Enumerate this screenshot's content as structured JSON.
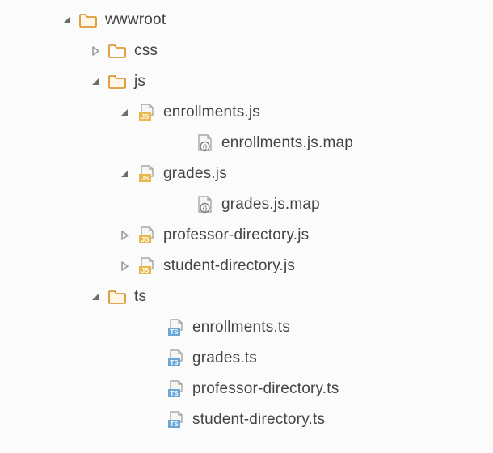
{
  "colors": {
    "folder_fill": "#ffffff",
    "folder_fill_open": "#fff6e6",
    "folder_stroke": "#d88a1a",
    "chevron_open": "#6d6d6d",
    "chevron_closed": "#9a9a9a",
    "js_badge": "#e9b84a",
    "ts_badge": "#6aa6d6",
    "file_page": "#f6f6f2",
    "file_stroke": "#9a9a9a",
    "map_icon": "#7a7a7a"
  },
  "tree": [
    {
      "depth": 2,
      "expand": "open",
      "icon": "folder-open",
      "label": "wwwroot",
      "name": "folder-wwwroot"
    },
    {
      "depth": 3,
      "expand": "closed",
      "icon": "folder",
      "label": "css",
      "name": "folder-css"
    },
    {
      "depth": 3,
      "expand": "open",
      "icon": "folder-open",
      "label": "js",
      "name": "folder-js"
    },
    {
      "depth": 4,
      "expand": "open",
      "icon": "js-file",
      "label": "enrollments.js",
      "name": "file-enrollments-js"
    },
    {
      "depth": 6,
      "expand": "none",
      "icon": "map-file",
      "label": "enrollments.js.map",
      "name": "file-enrollments-js-map"
    },
    {
      "depth": 4,
      "expand": "open",
      "icon": "js-file",
      "label": "grades.js",
      "name": "file-grades-js"
    },
    {
      "depth": 6,
      "expand": "none",
      "icon": "map-file",
      "label": "grades.js.map",
      "name": "file-grades-js-map"
    },
    {
      "depth": 4,
      "expand": "closed",
      "icon": "js-file",
      "label": "professor-directory.js",
      "name": "file-professor-directory-js"
    },
    {
      "depth": 4,
      "expand": "closed",
      "icon": "js-file",
      "label": "student-directory.js",
      "name": "file-student-directory-js"
    },
    {
      "depth": 3,
      "expand": "open",
      "icon": "folder-open",
      "label": "ts",
      "name": "folder-ts"
    },
    {
      "depth": 5,
      "expand": "none",
      "icon": "ts-file",
      "label": "enrollments.ts",
      "name": "file-enrollments-ts"
    },
    {
      "depth": 5,
      "expand": "none",
      "icon": "ts-file",
      "label": "grades.ts",
      "name": "file-grades-ts"
    },
    {
      "depth": 5,
      "expand": "none",
      "icon": "ts-file",
      "label": "professor-directory.ts",
      "name": "file-professor-directory-ts"
    },
    {
      "depth": 5,
      "expand": "none",
      "icon": "ts-file",
      "label": "student-directory.ts",
      "name": "file-student-directory-ts"
    }
  ]
}
